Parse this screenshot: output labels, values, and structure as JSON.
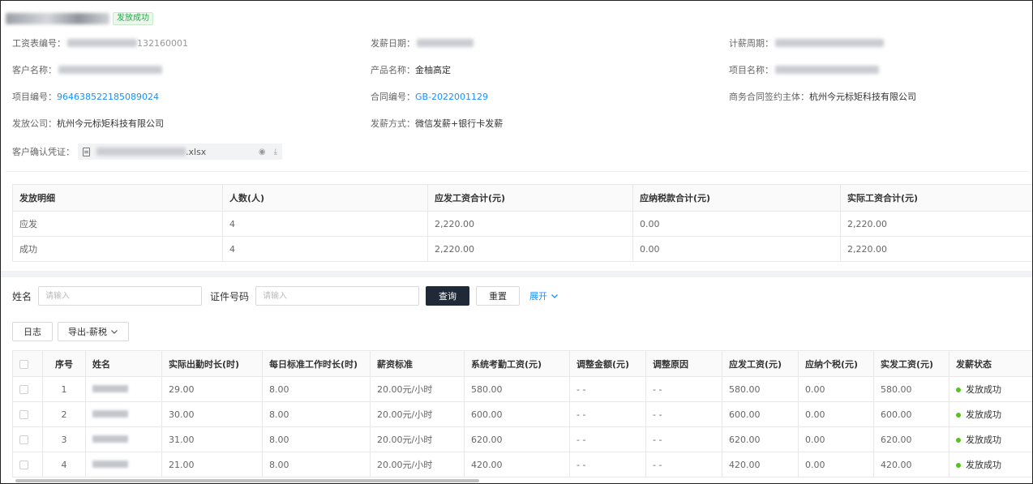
{
  "header": {
    "status_badge": "发放成功"
  },
  "info": {
    "salary_no_label": "工资表编号：",
    "salary_no_suffix": "132160001",
    "pay_date_label": "发薪日期：",
    "period_label": "计薪周期：",
    "customer_label": "客户名称：",
    "product_label": "产品名称：",
    "product_value": "金柚高定",
    "project_name_label": "项目名称：",
    "project_no_label": "项目编号：",
    "project_no_value": "964638522185089024",
    "contract_no_label": "合同编号：",
    "contract_no_value": "GB-2022001129",
    "biz_subject_label": "商务合同签约主体：",
    "biz_subject_value": "杭州今元标矩科技有限公司",
    "issuer_label": "发放公司：",
    "issuer_value": "杭州今元标矩科技有限公司",
    "method_label": "发薪方式：",
    "method_value": "微信发薪+银行卡发薪",
    "voucher_label": "客户确认凭证：",
    "voucher_ext": ".xlsx"
  },
  "summary": {
    "headers": [
      "发放明细",
      "人数(人)",
      "应发工资合计(元)",
      "应纳税款合计(元)",
      "实际工资合计(元)"
    ],
    "rows": [
      [
        "应发",
        "4",
        "2,220.00",
        "0.00",
        "2,220.00"
      ],
      [
        "成功",
        "4",
        "2,220.00",
        "0.00",
        "2,220.00"
      ]
    ]
  },
  "search": {
    "name_label": "姓名",
    "name_placeholder": "请输入",
    "id_label": "证件号码",
    "id_placeholder": "请输入",
    "query_button": "查询",
    "reset_button": "重置",
    "expand_link": "展开"
  },
  "toolbar": {
    "log_button": "日志",
    "export_button": "导出-薪税"
  },
  "table": {
    "headers": [
      "序号",
      "姓名",
      "实际出勤时长(时)",
      "每日标准工作时长(时)",
      "薪资标准",
      "系统考勤工资(元)",
      "调整金额(元)",
      "调整原因",
      "应发工资(元)",
      "应纳个税(元)",
      "实发工资(元)",
      "发薪状态"
    ],
    "rows": [
      {
        "no": "1",
        "hours": "29.00",
        "std_hours": "8.00",
        "rate": "20.00元/小时",
        "sys_pay": "580.00",
        "adj_amount": "- -",
        "adj_reason": "- -",
        "gross": "580.00",
        "tax": "0.00",
        "net": "580.00",
        "status": "发放成功"
      },
      {
        "no": "2",
        "hours": "30.00",
        "std_hours": "8.00",
        "rate": "20.00元/小时",
        "sys_pay": "600.00",
        "adj_amount": "- -",
        "adj_reason": "- -",
        "gross": "600.00",
        "tax": "0.00",
        "net": "600.00",
        "status": "发放成功"
      },
      {
        "no": "3",
        "hours": "31.00",
        "std_hours": "8.00",
        "rate": "20.00元/小时",
        "sys_pay": "620.00",
        "adj_amount": "- -",
        "adj_reason": "- -",
        "gross": "620.00",
        "tax": "0.00",
        "net": "620.00",
        "status": "发放成功"
      },
      {
        "no": "4",
        "hours": "21.00",
        "std_hours": "8.00",
        "rate": "20.00元/小时",
        "sys_pay": "420.00",
        "adj_amount": "- -",
        "adj_reason": "- -",
        "gross": "420.00",
        "tax": "0.00",
        "net": "420.00",
        "status": "发放成功"
      }
    ]
  },
  "colors": {
    "link": "#1890ff",
    "success": "#52c41a",
    "primary_button": "#1f2937"
  }
}
